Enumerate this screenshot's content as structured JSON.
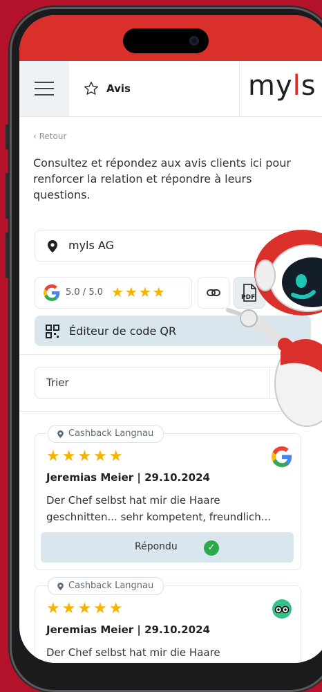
{
  "header": {
    "title": "Avis",
    "logo_text_a": "my",
    "logo_text_b": "l",
    "logo_text_c": "s"
  },
  "page": {
    "back_label": "‹ Retour",
    "intro": "Consultez et répondez aux avis clients ici pour renforcer la relation et répondre à leurs questions."
  },
  "location": {
    "selected": "myls AG"
  },
  "rating": {
    "score_text": "5.0 / 5.0",
    "stars": "★★★★"
  },
  "actions": {
    "pdf_label": "PDF",
    "qr_label": "Éditeur de code QR"
  },
  "sort": {
    "label": "Trier"
  },
  "reviews": [
    {
      "location": "Cashback Langnau",
      "stars": "★★★★★",
      "author": "Jeremias Meier | 29.10.2024",
      "text": "Der Chef selbst hat mir die Haare geschnitten... sehr kompetent, freundlich...",
      "status": "Répondu",
      "source": "google-icon"
    },
    {
      "location": "Cashback Langnau",
      "stars": "★★★★★",
      "author": "Jeremias Meier | 29.10.2024",
      "text": "Der Chef selbst hat mir die Haare",
      "source": "tripadvisor-icon"
    }
  ],
  "colors": {
    "background": "#b3122a",
    "statusbar": "#d9302b",
    "accent_light": "#d9e6ee",
    "star": "#f4b400",
    "success": "#2aa84a"
  }
}
